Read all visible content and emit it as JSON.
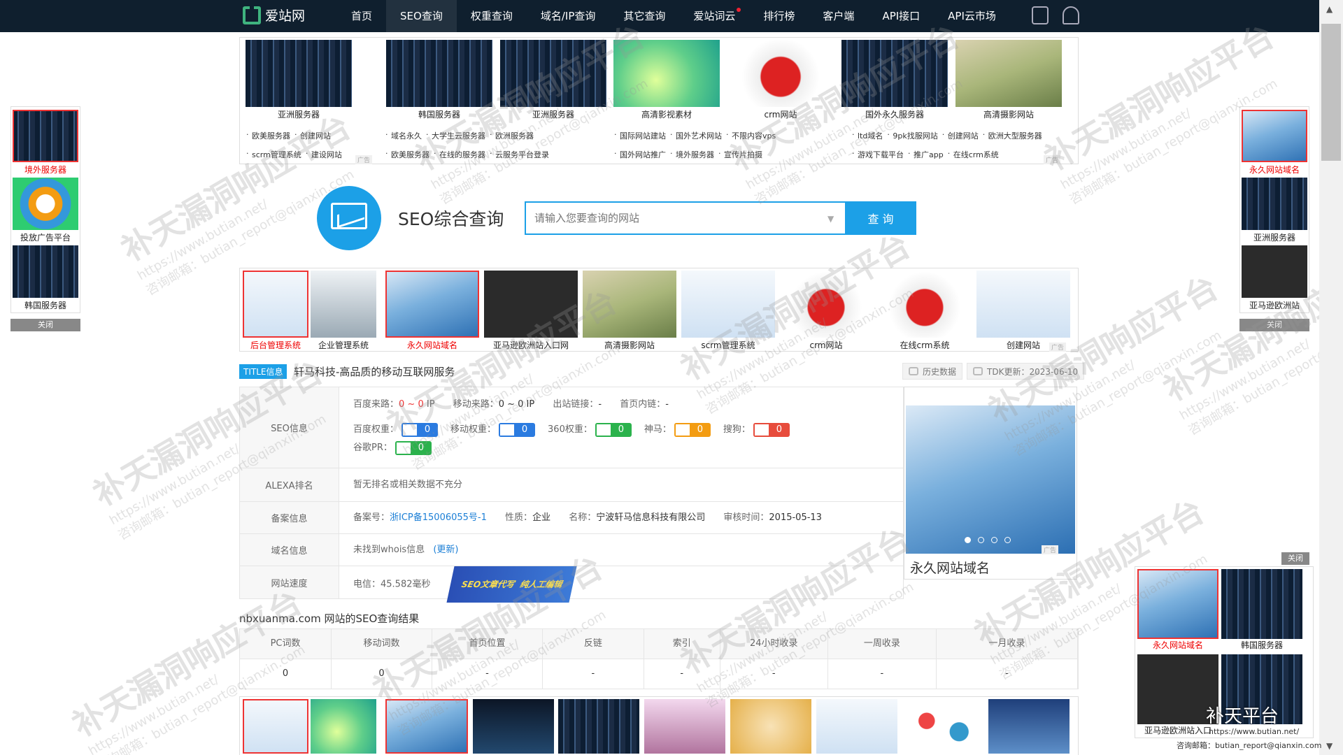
{
  "nav": {
    "logo_text": "爱站网",
    "items": [
      {
        "label": "首页"
      },
      {
        "label": "SEO查询"
      },
      {
        "label": "权重查询"
      },
      {
        "label": "域名/IP查询"
      },
      {
        "label": "其它查询"
      },
      {
        "label": "爱站词云"
      },
      {
        "label": "排行榜"
      },
      {
        "label": "客户端"
      },
      {
        "label": "API接口"
      },
      {
        "label": "API云市场"
      }
    ],
    "active_index": 1,
    "icons": [
      "mobile-icon",
      "user-icon"
    ]
  },
  "top_ads": {
    "cards": [
      {
        "label": "亚洲服务器",
        "image": "server"
      },
      {
        "label": "韩国服务器",
        "image": "server"
      },
      {
        "label": "亚洲服务器",
        "image": "server"
      },
      {
        "label": "高清影视素材",
        "image": "green"
      },
      {
        "label": "crm网站",
        "image": "crm"
      },
      {
        "label": "国外永久服务器",
        "image": "server"
      },
      {
        "label": "高清摄影网站",
        "image": "photo"
      }
    ],
    "link_rows": [
      [
        "欧美服务器",
        "创建网站"
      ],
      [
        "scrm管理系统",
        "建设网站"
      ],
      [
        "域名永久",
        "大学生云服务器",
        "欧洲服务器"
      ],
      [
        "欧美服务器",
        "在线的服务器",
        "云服务平台登录"
      ],
      [
        "国际网站建站",
        "国外艺术网站",
        "不限内容vps"
      ],
      [
        "国外网站推广",
        "境外服务器",
        "宣传片拍摄"
      ],
      [
        "ltd域名",
        "9pk找服网站",
        "创建网站",
        "欧洲大型服务器"
      ],
      [
        "游戏下载平台",
        "推广app",
        "在线crm系统"
      ]
    ]
  },
  "left_float": {
    "items": [
      {
        "label": "境外服务器",
        "image": "server",
        "red": true
      },
      {
        "label": "投放广告平台",
        "image": "ad",
        "red": false
      },
      {
        "label": "韩国服务器",
        "image": "server",
        "red": false
      }
    ],
    "close_label": "关闭"
  },
  "right_float": {
    "items": [
      {
        "label": "永久网站域名",
        "image": "www",
        "red": true
      },
      {
        "label": "亚洲服务器",
        "image": "server",
        "red": false
      },
      {
        "label": "亚马逊欧洲站",
        "image": "com",
        "red": false
      }
    ],
    "close_label": "关闭"
  },
  "search": {
    "title": "SEO综合查询",
    "placeholder": "请输入您要查询的网站",
    "button": "查 询"
  },
  "mid_ads": [
    {
      "label": "后台管理系统",
      "image": "mgmt",
      "red": true
    },
    {
      "label": "企业管理系统",
      "image": "laptop",
      "red": false
    },
    {
      "label": "永久网站域名",
      "image": "www",
      "red": true
    },
    {
      "label": "亚马逊欧洲站入口网",
      "image": "com",
      "red": false
    },
    {
      "label": "高清摄影网站",
      "image": "photo",
      "red": false
    },
    {
      "label": "scrm管理系统",
      "image": "mgmt",
      "red": false
    },
    {
      "label": "crm网站",
      "image": "crm",
      "red": false
    },
    {
      "label": "在线crm系统",
      "image": "crm",
      "red": false
    },
    {
      "label": "创建网站",
      "image": "mgmt",
      "red": false
    }
  ],
  "title_info": {
    "tag": "TITLE信息",
    "text": "轩马科技-高品质的移动互联网服务",
    "history_btn": "历史数据",
    "tdk_update": "TDK更新：2023-06-10"
  },
  "seo_info": {
    "label": "SEO信息",
    "baidu_source_label": "百度来路：",
    "baidu_source_value": "0 ~ 0",
    "baidu_source_unit": "IP",
    "mobile_source_label": "移动来路：",
    "mobile_source_value": "0 ~ 0 IP",
    "outlinks_label": "出站链接：",
    "outlinks_value": "-",
    "home_inlinks_label": "首页内链：",
    "home_inlinks_value": "-",
    "weights": [
      {
        "label": "百度权重：",
        "value": "0",
        "color": "#2b7be0",
        "icon": "paw-icon"
      },
      {
        "label": "移动权重：",
        "value": "0",
        "color": "#2b7be0",
        "icon": "paw-icon"
      },
      {
        "label": "360权重：",
        "value": "0",
        "color": "#2bb24c",
        "icon": "360-icon"
      },
      {
        "label": "神马：",
        "value": "0",
        "color": "#f39c12",
        "icon": "shenma-icon"
      },
      {
        "label": "搜狗：",
        "value": "0",
        "color": "#e74c3c",
        "icon": "sogou-icon"
      }
    ],
    "google_pr": {
      "label": "谷歌PR：",
      "value": "0",
      "color": "#2bb24c",
      "icon": "google-plus-icon"
    }
  },
  "alexa": {
    "label": "ALEXA排名",
    "value": "暂无排名或相关数据不充分"
  },
  "icp": {
    "label": "备案信息",
    "no_label": "备案号：",
    "no_value": "浙ICP备15006055号-1",
    "type_label": "性质：",
    "type_value": "企业",
    "name_label": "名称：",
    "name_value": "宁波轩马信息科技有限公司",
    "date_label": "审核时间：",
    "date_value": "2015-05-13"
  },
  "domain": {
    "label": "域名信息",
    "value": "未找到whois信息",
    "refresh": "(更新)"
  },
  "speed": {
    "label": "网站速度",
    "value": "电信：45.582毫秒",
    "banner_left": "SEO文章代写",
    "banner_right": "纯人工编辑"
  },
  "side_ad": {
    "caption": "永久网站域名",
    "image": "www",
    "ad_tag": "广告"
  },
  "results": {
    "title": "nbxuanma.com 网站的SEO查询结果",
    "headers": [
      "PC词数",
      "移动词数",
      "首页位置",
      "反链",
      "索引",
      "24小时收录",
      "一周收录",
      "一月收录"
    ],
    "values": [
      "0",
      "0",
      "-",
      "-",
      "-",
      "-",
      "-",
      "-"
    ]
  },
  "bottom_ads": [
    {
      "image": "mgmt",
      "red": true
    },
    {
      "image": "green",
      "red": false
    },
    {
      "image": "www",
      "red": true
    },
    {
      "image": "dark",
      "red": false
    },
    {
      "image": "server",
      "red": false
    },
    {
      "image": "girl",
      "red": false
    },
    {
      "image": "dotcom",
      "red": false
    },
    {
      "image": "mgmt",
      "red": false
    },
    {
      "image": "tags",
      "red": false
    },
    {
      "image": "ppt",
      "red": false
    }
  ],
  "bottom_right_float": {
    "close_label": "关闭",
    "items": [
      {
        "label": "永久网站域名",
        "image": "www",
        "red": true
      },
      {
        "label": "韩国服务器",
        "image": "server",
        "red": false
      },
      {
        "label": "亚马逊欧洲站入口",
        "image": "com",
        "red": false
      },
      {
        "label": "",
        "image": "server",
        "red": false
      }
    ],
    "watermark_title": "补天平台",
    "watermark_url": "https://www.butian.net/",
    "watermark_mail": "咨询邮箱：butian_report@qianxin.com"
  },
  "watermark": {
    "title": "补天漏洞响应平台",
    "url": "https://www.butian.net/",
    "mail": "咨询邮箱：butian_report@qianxin.com"
  }
}
